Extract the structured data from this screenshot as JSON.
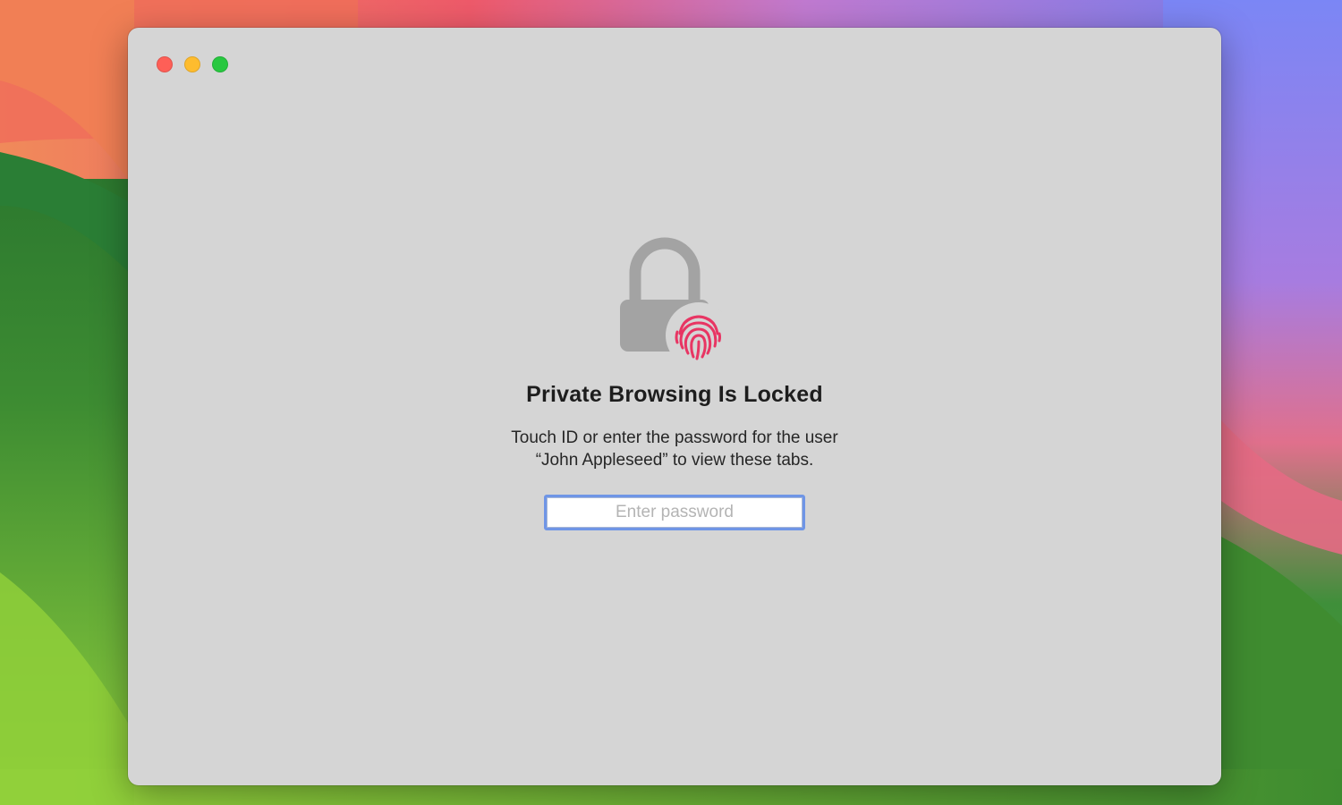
{
  "window": {
    "traffic_lights": [
      "close",
      "minimize",
      "zoom"
    ]
  },
  "lock": {
    "icon": "lock-icon",
    "badge_icon": "fingerprint-icon",
    "lock_color": "#a3a3a3",
    "fingerprint_color": "#e83563"
  },
  "title": "Private Browsing Is Locked",
  "message": {
    "line1": "Touch ID or enter the password for the user",
    "line2": "“John Appleseed” to view these tabs."
  },
  "password_field": {
    "placeholder": "Enter password",
    "value": ""
  },
  "colors": {
    "window_bg": "#d5d5d5",
    "focus_ring": "#6f95e6"
  }
}
